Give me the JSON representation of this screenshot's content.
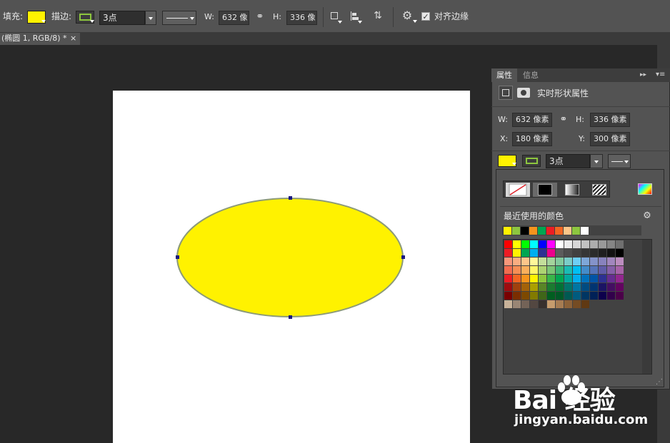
{
  "toolbar": {
    "fill_label": "填充:",
    "fill_color": "#fff200",
    "stroke_label": "描边:",
    "stroke_color": "#8dc63f",
    "stroke_width": "3点",
    "w_label": "W:",
    "w_value": "632 像",
    "link_icon": "link-icon",
    "h_label": "H:",
    "h_value": "336 像",
    "align_edges_label": "对齐边缘",
    "align_edges_checked": true
  },
  "document": {
    "tab_title": "(椭圆 1, RGB/8) *",
    "tab_close": "×",
    "canvas_color": "#ffffff",
    "shape": "ellipse",
    "shape_fill": "#fff200",
    "shape_stroke": "#8c9a78"
  },
  "panel": {
    "tabs": [
      "属性",
      "信息"
    ],
    "title": "实时形状属性",
    "w_label": "W:",
    "w_value": "632 像素",
    "h_label": "H:",
    "h_value": "336 像素",
    "x_label": "X:",
    "x_value": "180 像素",
    "y_label": "Y:",
    "y_value": "300 像素",
    "fill_color": "#fff200",
    "stroke_color": "#8dc63f",
    "stroke_width": "3点"
  },
  "color_popup": {
    "fill_types": [
      "no-color",
      "solid-color",
      "gradient",
      "pattern"
    ],
    "recent_label": "最近使用的颜色",
    "recent_colors": [
      "#fff200",
      "#8dc63f",
      "#000000",
      "#f7941d",
      "#00a651",
      "#ed1c24",
      "#f26522",
      "#fdc689",
      "#8dc63f",
      "#ffffff"
    ],
    "palette_rows": [
      [
        "#ff0000",
        "#ffff00",
        "#00ff00",
        "#00ffff",
        "#0000ff",
        "#ff00ff",
        "#ffffff",
        "#ebebeb",
        "#d7d7d7",
        "#c2c2c2",
        "#adadad",
        "#999999",
        "#858585",
        "#707070"
      ],
      [
        "#ed1c24",
        "#fff200",
        "#00a651",
        "#00aeef",
        "#2e3192",
        "#ec008c",
        "#5c5c5c",
        "#4d4d4d",
        "#414141",
        "#363636",
        "#2b2b2b",
        "#1f1f1f",
        "#121212",
        "#000000"
      ],
      [
        "#f7977a",
        "#f9ad81",
        "#fdc68a",
        "#fff79a",
        "#c4df9b",
        "#a3d39c",
        "#82ca9d",
        "#7bcdc8",
        "#6ecff6",
        "#7ea7d8",
        "#8493ca",
        "#8882be",
        "#a186be",
        "#bc8dbf"
      ],
      [
        "#f26c4f",
        "#f68e55",
        "#fbaf5c",
        "#fff467",
        "#acd372",
        "#7cc576",
        "#3bb878",
        "#1abbb4",
        "#00bff3",
        "#438cca",
        "#5574b9",
        "#605ca8",
        "#855fa8",
        "#a763a8"
      ],
      [
        "#ed1c24",
        "#f26522",
        "#f7941d",
        "#fff200",
        "#8dc63f",
        "#39b54a",
        "#00a651",
        "#00a99d",
        "#00aeef",
        "#0072bc",
        "#0054a6",
        "#2e3192",
        "#662d91",
        "#92278f"
      ],
      [
        "#9e0b0f",
        "#a0410d",
        "#a36209",
        "#aba000",
        "#598527",
        "#1a7b30",
        "#007236",
        "#00746b",
        "#0076a3",
        "#004b80",
        "#003471",
        "#1b1464",
        "#440e62",
        "#630460"
      ],
      [
        "#790000",
        "#7b2e00",
        "#7d4900",
        "#827b00",
        "#406618",
        "#005e20",
        "#005826",
        "#005952",
        "#005b7f",
        "#003663",
        "#002157",
        "#0d004c",
        "#32004b",
        "#4b0049"
      ],
      [
        "#c7b299",
        "#998675",
        "#736357",
        "#534741",
        "#37302d",
        "#c69c6d",
        "#a67c52",
        "#8c6239",
        "#754c24",
        "#603913"
      ]
    ]
  },
  "watermark": {
    "brand": "Bai  经验",
    "paw_icon": "baidu-paw-icon",
    "url": "jingyan.baidu.com"
  }
}
